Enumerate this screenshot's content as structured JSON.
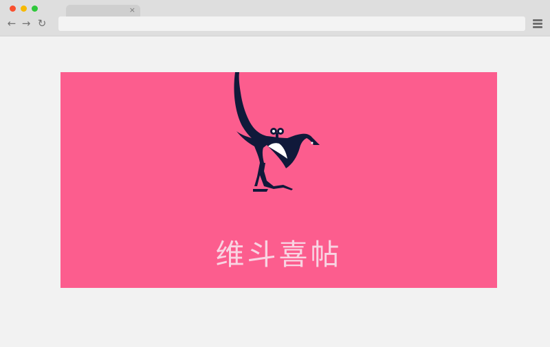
{
  "browser": {
    "traffic_lights": {
      "close_color": "#f9502f",
      "minimize_color": "#f7b900",
      "maximize_color": "#2fc83b"
    },
    "tab": {
      "close_glyph": "×"
    },
    "toolbar": {
      "back_icon": "←",
      "forward_icon": "→",
      "reload_icon": "↻",
      "address_value": "",
      "menu_icon": "hamburger-menu-icon"
    }
  },
  "banner": {
    "background_color": "#fc5d8e",
    "logo_icon": "magpie-bird-icon",
    "logo_color": "#10193a",
    "brand_name": "维斗喜帖"
  }
}
